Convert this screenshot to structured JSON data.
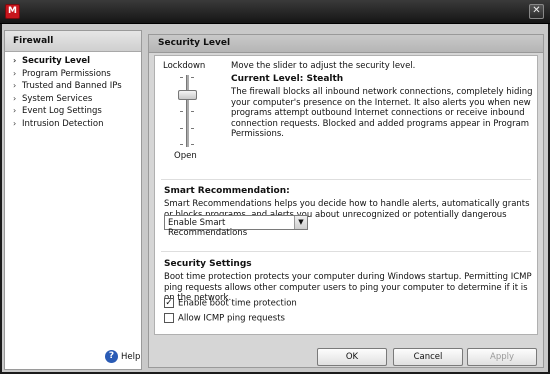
{
  "window": {
    "logo_letter": "M",
    "close_glyph": "✕"
  },
  "nav": {
    "header": "Firewall",
    "items": [
      {
        "label": "Security Level",
        "active": true
      },
      {
        "label": "Program Permissions",
        "active": false
      },
      {
        "label": "Trusted and Banned IPs",
        "active": false
      },
      {
        "label": "System Services",
        "active": false
      },
      {
        "label": "Event Log Settings",
        "active": false
      },
      {
        "label": "Intrusion Detection",
        "active": false
      }
    ],
    "help_label": "Help",
    "help_icon": "question-icon"
  },
  "panel": {
    "header": "Security Level",
    "slider": {
      "top_label": "Lockdown",
      "bottom_label": "Open",
      "instruction": "Move the slider to adjust the security level.",
      "current_level": "Current Level:  Stealth",
      "description": "The firewall blocks all inbound network connections, completely hiding your computer's presence on the Internet. It also alerts you when new programs attempt outbound Internet connections or receive inbound connection requests. Blocked and added programs appear in Program Permissions."
    },
    "smart_recommendation": {
      "title": "Smart Recommendation:",
      "text": "Smart Recommendations helps you decide how to handle alerts, automatically grants or blocks programs, and alerts you about unrecognized or potentially dangerous programs.",
      "select_value": "Enable Smart Recommendations"
    },
    "security_settings": {
      "title": "Security Settings",
      "text": "Boot time protection protects your computer during Windows startup. Permitting ICMP ping requests allows other computer users to ping your computer to determine if it is on the network.",
      "checkboxes": [
        {
          "label": "Enable boot time protection",
          "checked": true
        },
        {
          "label": "Allow ICMP ping requests",
          "checked": false
        }
      ]
    }
  },
  "buttons": {
    "ok": "OK",
    "cancel": "Cancel",
    "apply": "Apply"
  }
}
